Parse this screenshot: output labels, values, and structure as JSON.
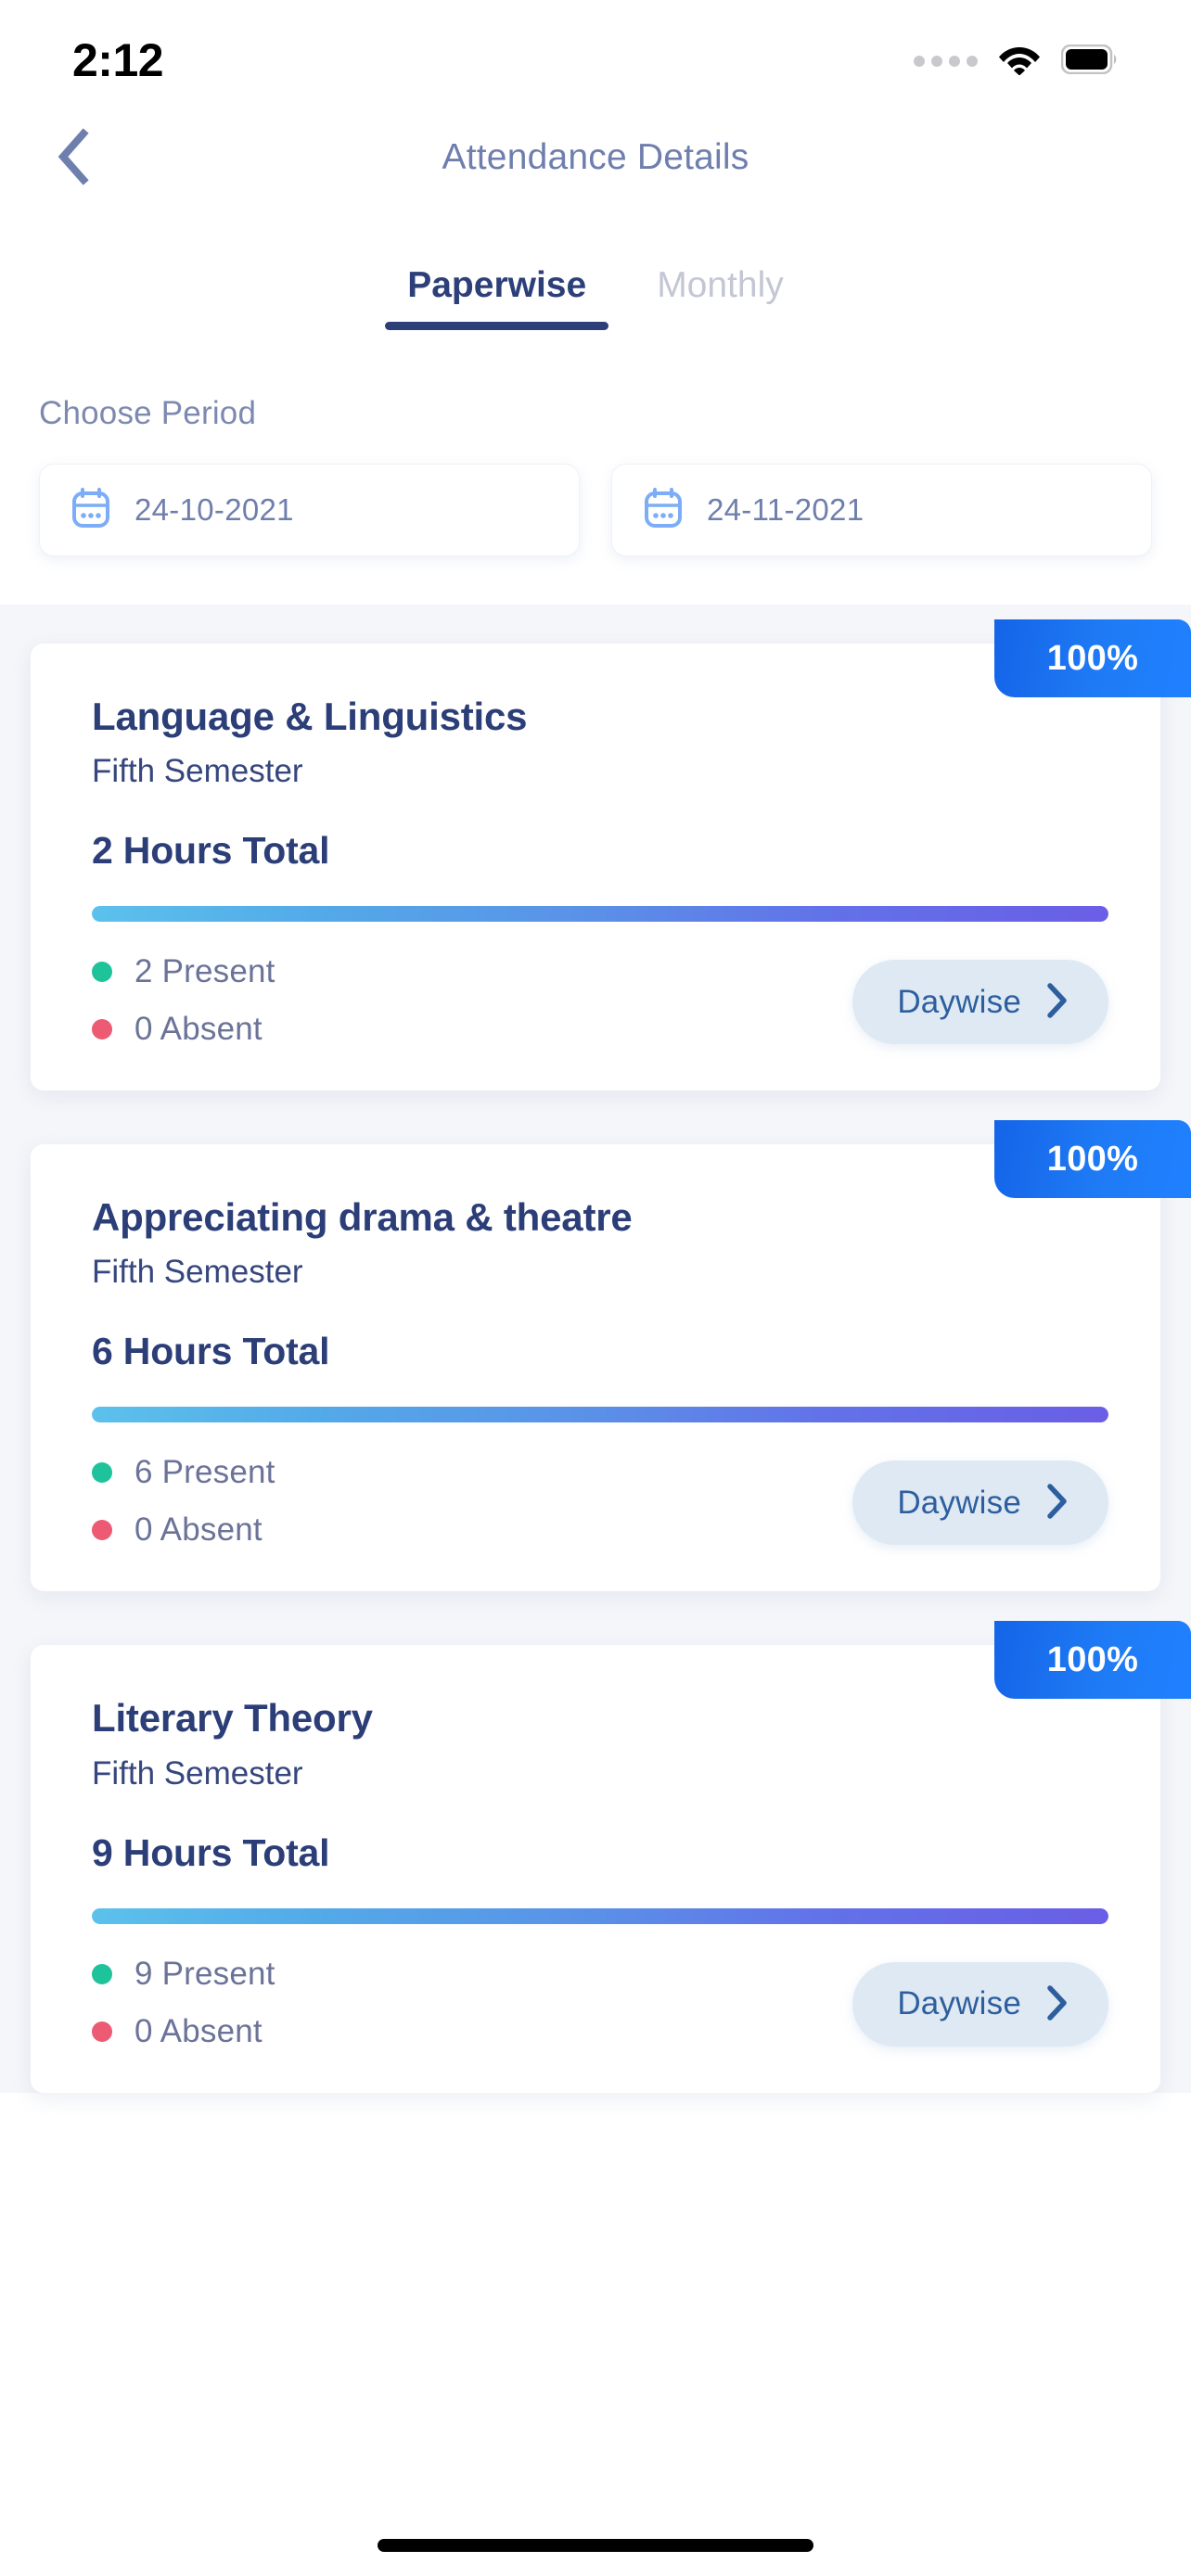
{
  "status_bar": {
    "time": "2:12",
    "signal_icon": "cellular-dots-icon",
    "wifi_icon": "wifi-icon",
    "battery_icon": "battery-icon"
  },
  "header": {
    "back_icon": "chevron-left-icon",
    "title": "Attendance Details"
  },
  "tabs": [
    {
      "label": "Paperwise",
      "active": true
    },
    {
      "label": "Monthly",
      "active": false
    }
  ],
  "period": {
    "label": "Choose Period",
    "calendar_icon": "calendar-icon",
    "from_date": "24-10-2021",
    "to_date": "24-11-2021"
  },
  "colors": {
    "accent_blue": "#1f7bf5",
    "navy": "#2c3e78",
    "muted": "#6f7fad",
    "present_green": "#1fc39b",
    "absent_red": "#ec5b73",
    "progress_start": "#5cc1ec",
    "progress_end": "#6a5ee6",
    "page_bg": "#f5f6fa",
    "daywise_bg": "#dfe9f4"
  },
  "cards": [
    {
      "badge": "100%",
      "title": "Language & Linguistics",
      "semester": "Fifth Semester",
      "hours_total": "2 Hours Total",
      "progress_percent": 100,
      "present": "2 Present",
      "absent": "0 Absent",
      "daywise_label": "Daywise",
      "daywise_icon": "chevron-right-icon"
    },
    {
      "badge": "100%",
      "title": "Appreciating drama & theatre",
      "semester": "Fifth Semester",
      "hours_total": "6 Hours Total",
      "progress_percent": 100,
      "present": "6 Present",
      "absent": "0 Absent",
      "daywise_label": "Daywise",
      "daywise_icon": "chevron-right-icon"
    },
    {
      "badge": "100%",
      "title": "Literary Theory",
      "semester": "Fifth Semester",
      "hours_total": "9 Hours Total",
      "progress_percent": 100,
      "present": "9 Present",
      "absent": "0 Absent",
      "daywise_label": "Daywise",
      "daywise_icon": "chevron-right-icon"
    }
  ]
}
